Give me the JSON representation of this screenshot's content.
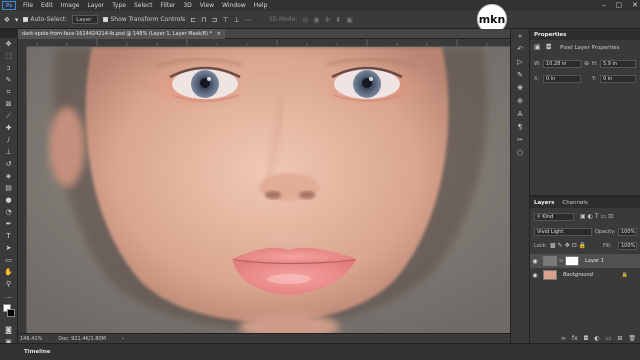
{
  "menubar": {
    "app_icon": "Ps",
    "items": [
      "File",
      "Edit",
      "Image",
      "Layer",
      "Type",
      "Select",
      "Filter",
      "3D",
      "View",
      "Window",
      "Help"
    ],
    "controls": [
      "minimize-icon",
      "maximize-icon",
      "close-icon"
    ]
  },
  "options": {
    "auto_select_label": "Auto-Select:",
    "auto_select_value": "Layer",
    "transform_label": "Show Transform Controls",
    "mode_3d_label": "3D Mode:"
  },
  "watermark": "mkn",
  "document": {
    "tab_title": "dark-spots-from-face-1614424214-lb.psd @ 146% (Layer 1, Layer Mask/8) *",
    "close_symbol": "×"
  },
  "status": {
    "zoom": "146.41%",
    "doc_size": "Doc: 921.4K/1.80M"
  },
  "timeline_label": "Timeline",
  "properties": {
    "tabs": [
      "Properties"
    ],
    "subtitle": "Pixel Layer Properties",
    "w_label": "W:",
    "w_value": "10.28 in",
    "h_label": "H:",
    "h_value": "5.9 in",
    "x_label": "X:",
    "x_value": "0 in",
    "y_label": "Y:",
    "y_value": "0 in",
    "link_symbol": "⊖"
  },
  "layers": {
    "tabs": [
      "Layers",
      "Channels"
    ],
    "filter_label": "Kind",
    "blend_mode": "Vivid Light",
    "opacity_label": "Opacity:",
    "opacity_value": "100%",
    "lock_label": "Lock:",
    "fill_label": "Fill:",
    "fill_value": "100%",
    "items": [
      {
        "name": "Layer 1",
        "selected": true
      },
      {
        "name": "Background",
        "selected": false
      }
    ]
  },
  "colors": {
    "ui_dark": "#282828",
    "panel": "#3a3a3a",
    "accent": "#3d8be0"
  }
}
